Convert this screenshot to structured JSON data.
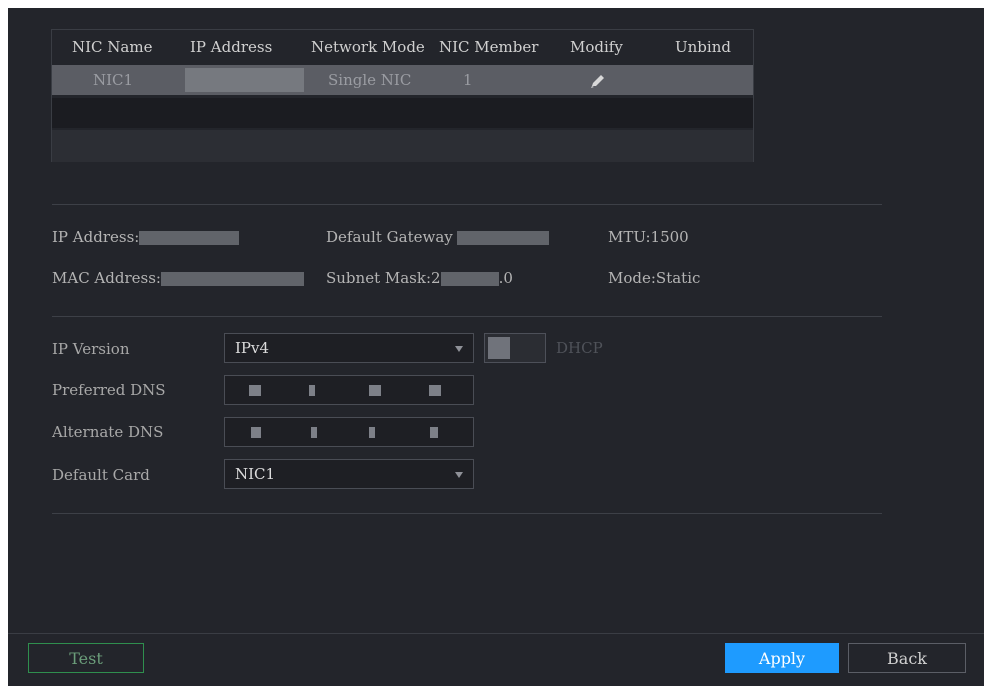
{
  "nic_table": {
    "headers": [
      "NIC Name",
      "IP Address",
      "Network Mode",
      "NIC Member",
      "Modify",
      "Unbind"
    ],
    "rows": [
      {
        "nic_name": "NIC1",
        "ip_address": "",
        "network_mode": "Single NIC",
        "nic_member": "1"
      }
    ]
  },
  "info": {
    "ip_address_label": "IP Address:",
    "default_gateway_label": "Default Gateway",
    "mtu": "MTU:1500",
    "mac_address_label": "MAC Address:",
    "subnet_mask_label": "Subnet Mask:2",
    "subnet_mask_tail": ".0",
    "mode": "Mode:Static"
  },
  "form": {
    "ip_version_label": "IP Version",
    "ip_version_value": "IPv4",
    "dhcp_label": "DHCP",
    "dhcp_enabled": false,
    "preferred_dns_label": "Preferred DNS",
    "alternate_dns_label": "Alternate DNS",
    "default_card_label": "Default Card",
    "default_card_value": "NIC1"
  },
  "footer": {
    "test_label": "Test",
    "apply_label": "Apply",
    "back_label": "Back"
  },
  "colors": {
    "background": "#23252b",
    "accent": "#1e9bff",
    "test_border": "#2f8f4e"
  },
  "icons": {
    "modify": "pencil-icon",
    "dropdown": "chevron-down-icon"
  }
}
